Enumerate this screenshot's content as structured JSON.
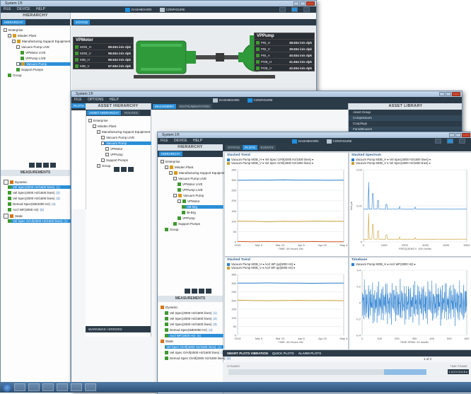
{
  "windows": {
    "back": {
      "title": "System 1®",
      "menu": [
        "FILE",
        "DEVICE",
        "HELP"
      ],
      "nav": {
        "dashboard": "DASHBOARD",
        "configure": "CONFIGURE"
      },
      "hierarchy_title": "HIERARCHY",
      "hierarchy_tab": "HIERARCHY",
      "tree": [
        "Enterprise",
        "Minden Plant",
        "Manufacturing Support Equipment",
        "Vacuum Pump LIVE",
        "VPMotor LIVE",
        "VPPump LIVE",
        "Vacuum Pump",
        "Support Pumps",
        "Group"
      ],
      "status_tab": "STATUS",
      "measurements_title": "MEASUREMENTS",
      "measurements": [
        {
          "label": "Dynamic",
          "n": ""
        },
        {
          "label": "Vel Spec(4000 Hz/1600 lines)",
          "n": "(1)"
        },
        {
          "label": "Vel Spec(4000 Hz/1600 lines)",
          "n": "(2)"
        },
        {
          "label": "Vel Spec(2000 Hz/1600 lines)",
          "n": "(3)"
        },
        {
          "label": "Demod Spec(WE2000 Hz)",
          "n": "(4)"
        },
        {
          "label": "Accl WF(3000 Hz)",
          "n": "(5)"
        },
        {
          "label": "Static",
          "n": ""
        },
        {
          "label": "Vel Spec O/All(4000 Hz/1600 lines)",
          "n": "(1)"
        }
      ],
      "vpmotor": {
        "title": "VPMotor",
        "rows": [
          {
            "k": "MOB_H",
            "v": "89.834 in/s dpk"
          },
          {
            "k": "MOB_V",
            "v": "98.834 in/s dpk"
          },
          {
            "k": "MIB_H",
            "v": "86.634 in/s dpk"
          },
          {
            "k": "MIB_V",
            "v": "67.834 in/s dpk"
          }
        ]
      },
      "vppump": {
        "title": "VPPump",
        "rows": [
          {
            "k": "PIB_H",
            "v": "38.834 in/s dpk"
          },
          {
            "k": "PIB_V",
            "v": "39.834 in/s dpk"
          },
          {
            "k": "PIB_A",
            "v": "40.834 in/s dpk"
          },
          {
            "k": "POB_H",
            "v": "41.834 in/s dpk"
          },
          {
            "k": "POB_V",
            "v": "42.834 in/s dpk"
          }
        ]
      }
    },
    "mid": {
      "title": "System 1®",
      "menu": [
        "FILE",
        "OPTIONS",
        "HELP"
      ],
      "nav": {
        "dashboard": "DASHBOARD",
        "configure": "CONFIGURE"
      },
      "asset_hierarchy_title": "ASSET HIERARCHY",
      "tabs": [
        "ASSET HIERARCHY",
        "ROUTES"
      ],
      "content_tabs": [
        "MACHINERY",
        "INSTRUMENTATION"
      ],
      "tree": [
        "Enterprise",
        "Minden Plant",
        "Manufacturing Support Equipment",
        "Vacuum Pump LIVE",
        "Vacuum Pump",
        "VPMotor",
        "VPPump",
        "Support Pumps",
        "Group"
      ],
      "measurements_title": "MEASUREMENTS",
      "asset_library_title": "ASSET LIBRARY",
      "asset_library": [
        "Asset Group",
        "Compressors",
        "Couplings",
        "Fans/Blowers"
      ],
      "plots_tab": "PLOTS",
      "warnings": "WARNINGS / ERRORS"
    },
    "front": {
      "title": "System 1®",
      "menu": [
        "FILE",
        "DEVICE",
        "HELP"
      ],
      "nav": {
        "dashboard": "DASHBOARD",
        "configure": "CONFIGURE"
      },
      "hierarchy_title": "HIERARCHY",
      "hierarchy_tab": "HIERARCHY",
      "tree": [
        "Enterprise",
        "Minden Plant",
        "Manufacturing Support Equipment",
        "Vacuum Pump LIVE",
        "VPMotor LIVE",
        "VPPump LIVE",
        "Vacuum Pump",
        "VPMotor",
        "OB-Brg",
        "IB-Brg",
        "VPPump",
        "Support Pumps",
        "Group"
      ],
      "content_tabs": [
        "STATUS",
        "PLOTS",
        "EVENTS"
      ],
      "measurements_title": "MEASUREMENTS",
      "measurements": [
        {
          "label": "Dynamic",
          "n": ""
        },
        {
          "label": "Vel Spec(4000 Hz/1600 lines)",
          "n": "(1)"
        },
        {
          "label": "Vel Spec(4000 Hz/1600 lines)",
          "n": "(2)"
        },
        {
          "label": "Vel Spec(2000 Hz/1600 lines)",
          "n": "(3)"
        },
        {
          "label": "Demod Spec(WE2000 Hz)",
          "n": "(4)"
        },
        {
          "label": "Accl WF(3000 Hz)",
          "n": "(5)"
        },
        {
          "label": "Static",
          "n": ""
        },
        {
          "label": "Vel Spec O/All(4000 Hz/1600 lines)",
          "n": "(1)"
        },
        {
          "label": "Vel Spec O/All(4000 Hz/1600 lines)",
          "n": "(2)"
        },
        {
          "label": "Demod Spec O/All(2000 Hz/1600 lines)",
          "n": "(3)"
        }
      ],
      "bottom_tabs": [
        "SMART PLOTS VIBRATION",
        "QUICK PLOTS",
        "ALARM PLOTS"
      ],
      "page": "1 of 2",
      "time_frame": "TIME FRAME",
      "range_btn": "1 d 2 h 3 m 5 s",
      "dynamic_label": "DYNAMIC"
    }
  },
  "chart_data": [
    {
      "type": "line",
      "title": "Stacked Trend",
      "series": [
        {
          "name": "Vacuum Pump MOB_H ▾ Vel Spec O/All(4000 Hz/1600 lines) ▾",
          "color": "#2a7fd0",
          "values": [
            299,
            300,
            300,
            301,
            300,
            300,
            299,
            300
          ]
        },
        {
          "name": "Vacuum Pump MOB_V ▾ Vel Spec O/All(4000 Hz/1600 lines) ▾",
          "color": "#c8a032",
          "values": [
            101,
            100,
            98,
            100,
            99,
            101,
            100,
            100
          ]
        },
        {
          "name": "",
          "color": "#d9541a",
          "values": [
            2,
            1,
            2,
            1,
            1,
            2,
            1,
            1
          ]
        }
      ],
      "x_labels": [
        "2015",
        "Mar 9",
        "Mar 23",
        "Apr 6",
        "Apr 20",
        "May 4"
      ],
      "xlabel": "TIME: 46 Hours /div",
      "y_labels": [
        "0",
        "50",
        "100",
        "150",
        "200",
        "250",
        "300",
        "350"
      ],
      "ylim": [
        0,
        350
      ]
    },
    {
      "type": "line",
      "title": "Stacked Spectrum",
      "series": [
        {
          "name": "Vacuum Pump MOB_H ▾ Vel Spec(4000 Hz/1600 lines) ▾",
          "color": "#2a7fd0"
        },
        {
          "name": "Vacuum Pump MOB_V ▾ Vel Spec(4000 Hz/1600 lines) ▾",
          "color": "#c8a032"
        }
      ],
      "x_labels": [
        "0",
        "1000",
        "2000",
        "3000",
        "4000",
        "5000"
      ],
      "xlabel": "FREQUENCY: 100 Hz/div",
      "y_labels": [
        "0",
        "0.01",
        "0.02"
      ],
      "ylabel": "in/s pk"
    },
    {
      "type": "line",
      "title": "Stacked Trend",
      "series": [
        {
          "name": "Vacuum Pump MOB_H ▾ Accl WF pp(3000 Hz) ▾",
          "color": "#2a7fd0",
          "values": [
            300,
            300,
            301,
            300,
            300,
            299,
            300,
            300
          ]
        },
        {
          "name": "Vacuum Pump MOB_V ▾ Accl WF pp(3000 Hz) ▾",
          "color": "#c8a032",
          "values": [
            202,
            200,
            199,
            200,
            201,
            200,
            200,
            199
          ]
        }
      ],
      "x_labels": [
        "2015",
        "Mar 9",
        "Mar 23",
        "Apr 6",
        "Apr 20",
        "May 4"
      ],
      "xlabel": "TIME: 46 Hours /div",
      "y_labels": [
        "0",
        "50",
        "100",
        "150",
        "200",
        "250",
        "300",
        "350"
      ],
      "ylim": [
        0,
        350
      ]
    },
    {
      "type": "line",
      "title": "Timebase",
      "series": [
        {
          "name": "Vacuum Pump MOB_H ▾ Accl WF(3000 Hz) ▾",
          "color": "#2a7fd0"
        }
      ],
      "x_labels": [
        "0",
        "100",
        "200",
        "300",
        "400",
        "500",
        "600"
      ],
      "xlabel": "TIME SPAN: 20 ms/div",
      "y_labels": [
        "-0.4",
        "-0.2",
        "0",
        "0.2",
        "0.4"
      ],
      "ylim": [
        -0.4,
        0.4
      ]
    }
  ]
}
